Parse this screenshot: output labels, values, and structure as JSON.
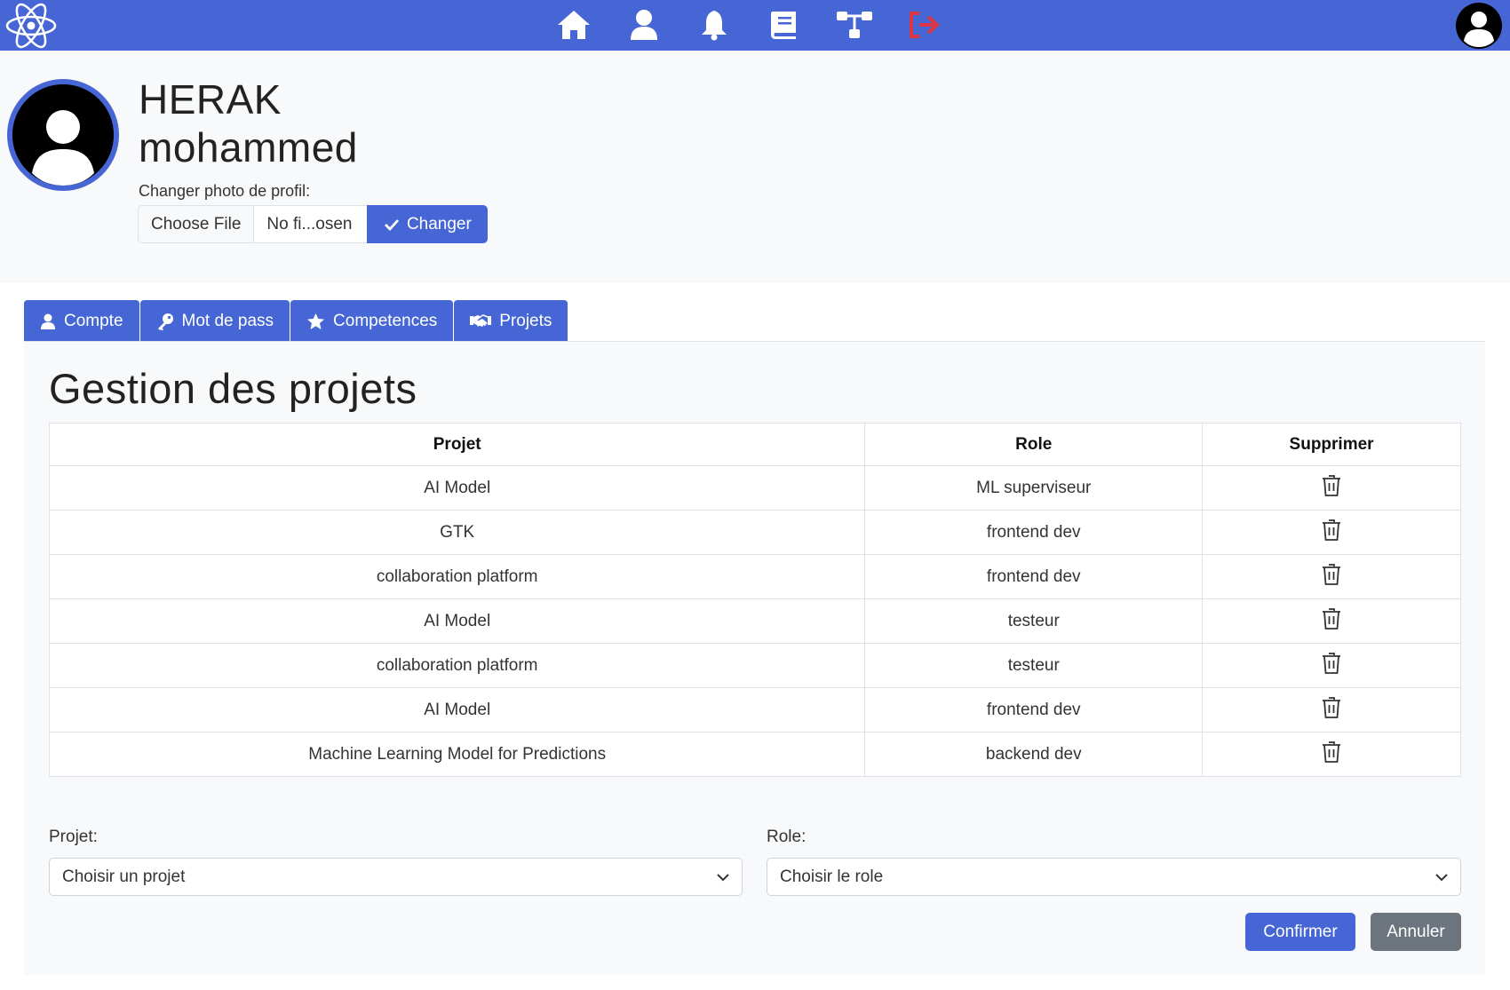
{
  "navbar": {
    "logo_icon": "atom-logo-icon",
    "icons": [
      {
        "name": "home-icon"
      },
      {
        "name": "user-icon"
      },
      {
        "name": "bell-icon"
      },
      {
        "name": "book-icon"
      },
      {
        "name": "sitemap-icon"
      },
      {
        "name": "logout-icon",
        "color": "#dc3545"
      }
    ],
    "avatar_icon": "user-avatar-icon",
    "background": "#4766d6"
  },
  "profile": {
    "last_name": "HERAK",
    "first_name": "mohammed",
    "photo_label": "Changer photo de profil:",
    "file_button": "Choose File",
    "file_name": "No fi...osen",
    "change_button": "Changer"
  },
  "tabs": [
    {
      "label": "Compte",
      "icon": "user-icon"
    },
    {
      "label": "Mot de pass",
      "icon": "key-icon"
    },
    {
      "label": "Competences",
      "icon": "star-icon"
    },
    {
      "label": "Projets",
      "icon": "handshake-icon"
    }
  ],
  "projects": {
    "title": "Gestion des projets",
    "columns": [
      "Projet",
      "Role",
      "Supprimer"
    ],
    "rows": [
      {
        "projet": "AI Model",
        "role": "ML superviseur"
      },
      {
        "projet": "GTK",
        "role": "frontend dev"
      },
      {
        "projet": "collaboration platform",
        "role": "frontend dev"
      },
      {
        "projet": "AI Model",
        "role": "testeur"
      },
      {
        "projet": "collaboration platform",
        "role": "testeur"
      },
      {
        "projet": "AI Model",
        "role": "frontend dev"
      },
      {
        "projet": "Machine Learning Model for Predictions",
        "role": "backend dev"
      }
    ],
    "form": {
      "projet_label": "Projet:",
      "projet_placeholder": "Choisir un projet",
      "role_label": "Role:",
      "role_placeholder": "Choisir le role",
      "confirm_button": "Confirmer",
      "cancel_button": "Annuler"
    }
  },
  "colors": {
    "primary": "#4766d6",
    "secondary": "#6c757d",
    "danger": "#dc3545"
  }
}
